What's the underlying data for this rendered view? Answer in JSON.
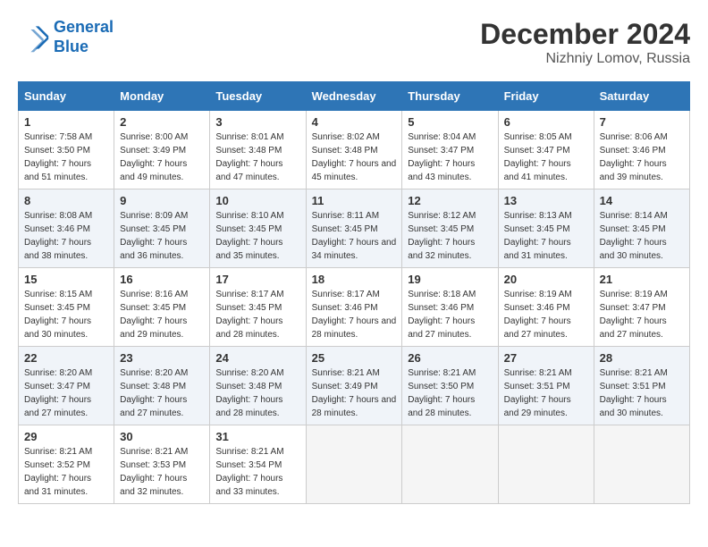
{
  "header": {
    "logo_line1": "General",
    "logo_line2": "Blue",
    "main_title": "December 2024",
    "subtitle": "Nizhniy Lomov, Russia"
  },
  "calendar": {
    "days_of_week": [
      "Sunday",
      "Monday",
      "Tuesday",
      "Wednesday",
      "Thursday",
      "Friday",
      "Saturday"
    ],
    "weeks": [
      [
        null,
        null,
        null,
        null,
        null,
        null,
        null
      ]
    ],
    "cells": [
      [
        {
          "day": "1",
          "sunrise": "Sunrise: 7:58 AM",
          "sunset": "Sunset: 3:50 PM",
          "daylight": "Daylight: 7 hours and 51 minutes."
        },
        {
          "day": "2",
          "sunrise": "Sunrise: 8:00 AM",
          "sunset": "Sunset: 3:49 PM",
          "daylight": "Daylight: 7 hours and 49 minutes."
        },
        {
          "day": "3",
          "sunrise": "Sunrise: 8:01 AM",
          "sunset": "Sunset: 3:48 PM",
          "daylight": "Daylight: 7 hours and 47 minutes."
        },
        {
          "day": "4",
          "sunrise": "Sunrise: 8:02 AM",
          "sunset": "Sunset: 3:48 PM",
          "daylight": "Daylight: 7 hours and 45 minutes."
        },
        {
          "day": "5",
          "sunrise": "Sunrise: 8:04 AM",
          "sunset": "Sunset: 3:47 PM",
          "daylight": "Daylight: 7 hours and 43 minutes."
        },
        {
          "day": "6",
          "sunrise": "Sunrise: 8:05 AM",
          "sunset": "Sunset: 3:47 PM",
          "daylight": "Daylight: 7 hours and 41 minutes."
        },
        {
          "day": "7",
          "sunrise": "Sunrise: 8:06 AM",
          "sunset": "Sunset: 3:46 PM",
          "daylight": "Daylight: 7 hours and 39 minutes."
        }
      ],
      [
        {
          "day": "8",
          "sunrise": "Sunrise: 8:08 AM",
          "sunset": "Sunset: 3:46 PM",
          "daylight": "Daylight: 7 hours and 38 minutes."
        },
        {
          "day": "9",
          "sunrise": "Sunrise: 8:09 AM",
          "sunset": "Sunset: 3:45 PM",
          "daylight": "Daylight: 7 hours and 36 minutes."
        },
        {
          "day": "10",
          "sunrise": "Sunrise: 8:10 AM",
          "sunset": "Sunset: 3:45 PM",
          "daylight": "Daylight: 7 hours and 35 minutes."
        },
        {
          "day": "11",
          "sunrise": "Sunrise: 8:11 AM",
          "sunset": "Sunset: 3:45 PM",
          "daylight": "Daylight: 7 hours and 34 minutes."
        },
        {
          "day": "12",
          "sunrise": "Sunrise: 8:12 AM",
          "sunset": "Sunset: 3:45 PM",
          "daylight": "Daylight: 7 hours and 32 minutes."
        },
        {
          "day": "13",
          "sunrise": "Sunrise: 8:13 AM",
          "sunset": "Sunset: 3:45 PM",
          "daylight": "Daylight: 7 hours and 31 minutes."
        },
        {
          "day": "14",
          "sunrise": "Sunrise: 8:14 AM",
          "sunset": "Sunset: 3:45 PM",
          "daylight": "Daylight: 7 hours and 30 minutes."
        }
      ],
      [
        {
          "day": "15",
          "sunrise": "Sunrise: 8:15 AM",
          "sunset": "Sunset: 3:45 PM",
          "daylight": "Daylight: 7 hours and 30 minutes."
        },
        {
          "day": "16",
          "sunrise": "Sunrise: 8:16 AM",
          "sunset": "Sunset: 3:45 PM",
          "daylight": "Daylight: 7 hours and 29 minutes."
        },
        {
          "day": "17",
          "sunrise": "Sunrise: 8:17 AM",
          "sunset": "Sunset: 3:45 PM",
          "daylight": "Daylight: 7 hours and 28 minutes."
        },
        {
          "day": "18",
          "sunrise": "Sunrise: 8:17 AM",
          "sunset": "Sunset: 3:46 PM",
          "daylight": "Daylight: 7 hours and 28 minutes."
        },
        {
          "day": "19",
          "sunrise": "Sunrise: 8:18 AM",
          "sunset": "Sunset: 3:46 PM",
          "daylight": "Daylight: 7 hours and 27 minutes."
        },
        {
          "day": "20",
          "sunrise": "Sunrise: 8:19 AM",
          "sunset": "Sunset: 3:46 PM",
          "daylight": "Daylight: 7 hours and 27 minutes."
        },
        {
          "day": "21",
          "sunrise": "Sunrise: 8:19 AM",
          "sunset": "Sunset: 3:47 PM",
          "daylight": "Daylight: 7 hours and 27 minutes."
        }
      ],
      [
        {
          "day": "22",
          "sunrise": "Sunrise: 8:20 AM",
          "sunset": "Sunset: 3:47 PM",
          "daylight": "Daylight: 7 hours and 27 minutes."
        },
        {
          "day": "23",
          "sunrise": "Sunrise: 8:20 AM",
          "sunset": "Sunset: 3:48 PM",
          "daylight": "Daylight: 7 hours and 27 minutes."
        },
        {
          "day": "24",
          "sunrise": "Sunrise: 8:20 AM",
          "sunset": "Sunset: 3:48 PM",
          "daylight": "Daylight: 7 hours and 28 minutes."
        },
        {
          "day": "25",
          "sunrise": "Sunrise: 8:21 AM",
          "sunset": "Sunset: 3:49 PM",
          "daylight": "Daylight: 7 hours and 28 minutes."
        },
        {
          "day": "26",
          "sunrise": "Sunrise: 8:21 AM",
          "sunset": "Sunset: 3:50 PM",
          "daylight": "Daylight: 7 hours and 28 minutes."
        },
        {
          "day": "27",
          "sunrise": "Sunrise: 8:21 AM",
          "sunset": "Sunset: 3:51 PM",
          "daylight": "Daylight: 7 hours and 29 minutes."
        },
        {
          "day": "28",
          "sunrise": "Sunrise: 8:21 AM",
          "sunset": "Sunset: 3:51 PM",
          "daylight": "Daylight: 7 hours and 30 minutes."
        }
      ],
      [
        {
          "day": "29",
          "sunrise": "Sunrise: 8:21 AM",
          "sunset": "Sunset: 3:52 PM",
          "daylight": "Daylight: 7 hours and 31 minutes."
        },
        {
          "day": "30",
          "sunrise": "Sunrise: 8:21 AM",
          "sunset": "Sunset: 3:53 PM",
          "daylight": "Daylight: 7 hours and 32 minutes."
        },
        {
          "day": "31",
          "sunrise": "Sunrise: 8:21 AM",
          "sunset": "Sunset: 3:54 PM",
          "daylight": "Daylight: 7 hours and 33 minutes."
        },
        null,
        null,
        null,
        null
      ]
    ]
  }
}
